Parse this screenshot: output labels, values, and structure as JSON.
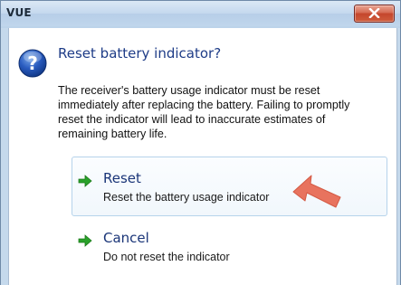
{
  "window": {
    "title": "VUE"
  },
  "dialog": {
    "heading": "Reset battery indicator?",
    "body": "The receiver's battery usage indicator must be reset immediately after replacing the battery. Failing to promptly reset the indicator will lead to inaccurate estimates of remaining battery life.",
    "icon": "question-icon"
  },
  "commands": [
    {
      "title": "Reset",
      "description": "Reset the battery usage indicator",
      "icon": "green-arrow-icon",
      "hovered": true
    },
    {
      "title": "Cancel",
      "description": "Do not reset the indicator",
      "icon": "green-arrow-icon",
      "hovered": false
    }
  ],
  "annotation": {
    "icon": "red-pointer-arrow",
    "color": "#e8735e"
  },
  "colors": {
    "heading": "#1e3c87",
    "link": "#1a3578",
    "arrow_green": "#2aa12a",
    "close_red": "#c4462c"
  }
}
